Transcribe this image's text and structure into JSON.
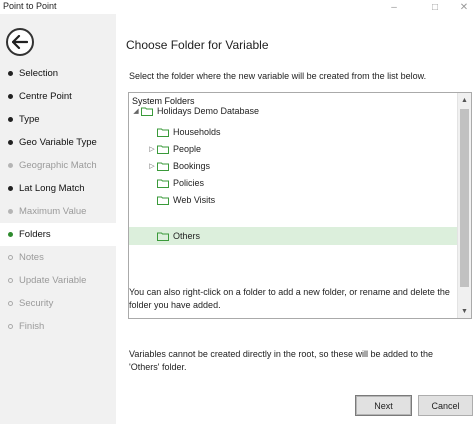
{
  "window": {
    "title": "Point to Point"
  },
  "sidebar": {
    "items": [
      {
        "label": "Selection",
        "state": "done"
      },
      {
        "label": "Centre Point",
        "state": "done"
      },
      {
        "label": "Type",
        "state": "done"
      },
      {
        "label": "Geo Variable Type",
        "state": "done"
      },
      {
        "label": "Geographic Match",
        "state": "disabled"
      },
      {
        "label": "Lat Long Match",
        "state": "done"
      },
      {
        "label": "Maximum Value",
        "state": "disabled"
      },
      {
        "label": "Folders",
        "state": "current"
      },
      {
        "label": "Notes",
        "state": "pending"
      },
      {
        "label": "Update Variable",
        "state": "pending"
      },
      {
        "label": "Security",
        "state": "pending"
      },
      {
        "label": "Finish",
        "state": "pending"
      }
    ]
  },
  "main": {
    "title": "Choose Folder for Variable",
    "instruction": "Select the folder where the new variable will be created from the list below.",
    "tree": {
      "header": "System Folders",
      "nodes": [
        {
          "label": "Holidays Demo Database",
          "expander": "◢",
          "level": 0
        },
        {
          "label": "Households",
          "expander": "",
          "level": 1
        },
        {
          "label": "People",
          "expander": "▷",
          "level": 1
        },
        {
          "label": "Bookings",
          "expander": "▷",
          "level": 1
        },
        {
          "label": "Policies",
          "expander": "",
          "level": 1
        },
        {
          "label": "Web Visits",
          "expander": "",
          "level": 1
        },
        {
          "label": "Others",
          "expander": "",
          "level": 1,
          "selected": true
        }
      ]
    },
    "note1": "You can also right-click on a folder to add a new folder, or rename and delete the folder you have added.",
    "note2": "Variables cannot be created directly in the root, so these will be added to the 'Others' folder.",
    "buttons": {
      "next": "Next",
      "cancel": "Cancel"
    }
  },
  "colors": {
    "accent_green": "#2e8b2e",
    "folder_green": "#3a9a3a",
    "selection_bg": "#dcefdc",
    "sidebar_bg": "#f1f1f1"
  }
}
